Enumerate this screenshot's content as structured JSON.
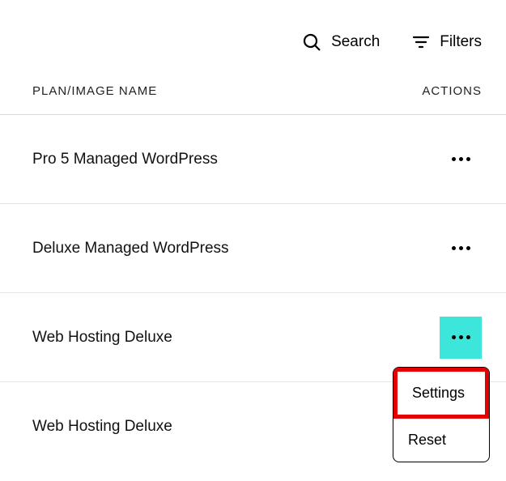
{
  "toolbar": {
    "search_label": "Search",
    "filters_label": "Filters"
  },
  "table": {
    "header_plan": "PLAN/IMAGE NAME",
    "header_actions": "ACTIONS",
    "rows": [
      {
        "name": "Pro 5 Managed WordPress",
        "active": false
      },
      {
        "name": "Deluxe Managed WordPress",
        "active": false
      },
      {
        "name": "Web Hosting Deluxe",
        "active": true
      },
      {
        "name": "Web Hosting Deluxe",
        "active": false
      }
    ]
  },
  "dropdown": {
    "items": [
      {
        "label": "Settings",
        "highlighted": true
      },
      {
        "label": "Reset",
        "highlighted": false
      }
    ]
  }
}
